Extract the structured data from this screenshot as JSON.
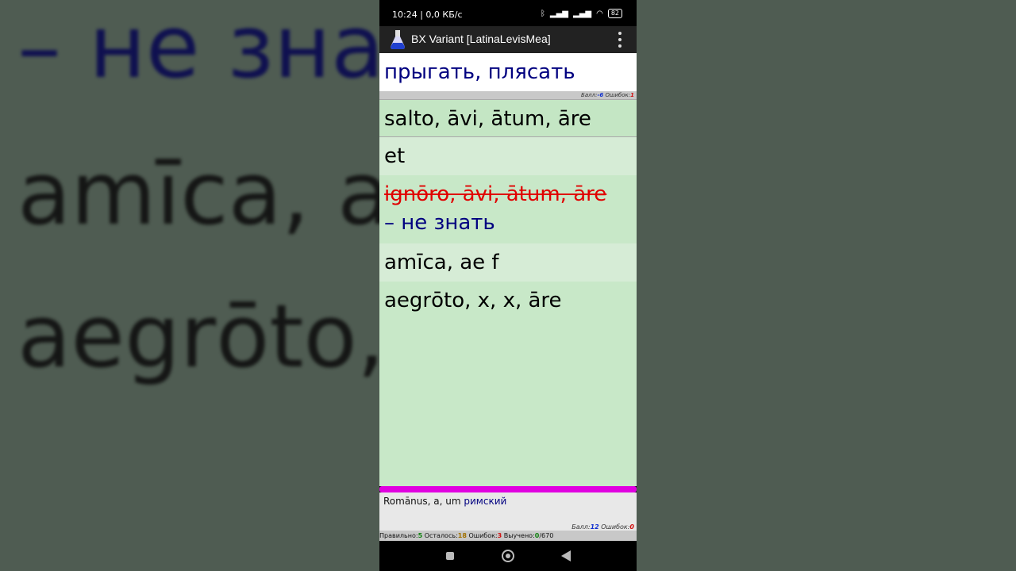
{
  "background_text": {
    "line1": "– не зна",
    "line2": "amīca, a",
    "line3": "aegrōto,   āre"
  },
  "status_bar": {
    "time": "10:24 | 0,0 КБ/с",
    "battery": "82"
  },
  "app_bar": {
    "title": "BX Variant [LatinaLevisMea]"
  },
  "question": {
    "text": "прыгать, плясать"
  },
  "score_top": {
    "score_label": "Балл:",
    "score_value": "-6",
    "errors_label": "Ошибок:",
    "errors_value": "1"
  },
  "options": {
    "items": [
      {
        "text": "salto, āvi, ātum, āre"
      },
      {
        "text": "et"
      },
      {
        "text": "ignōro, āvi, ātum, āre",
        "translation": "– не знать"
      },
      {
        "text": "amīca, ae f"
      },
      {
        "text": "aegrōto, x, x, āre"
      }
    ]
  },
  "progress": {
    "fraction": 1.0
  },
  "hint": {
    "latin": "Romānus, a, um",
    "russian": "римский",
    "score_label": "Балл:",
    "score_value": "12",
    "errors_label": "Ошибок:",
    "errors_value": "0"
  },
  "stats": {
    "correct_label": "Правильно:",
    "correct_value": "5",
    "left_label": "Осталось:",
    "left_value": "18",
    "errors_label": "Ошибок:",
    "errors_value": "3",
    "learned_label": "Выучено:",
    "learned_value": "0",
    "total": "/670"
  },
  "colors": {
    "accent_progress": "#e000e0",
    "option_bg": "#c8e8c8",
    "wrong": "#e00000",
    "translation": "#000080"
  }
}
